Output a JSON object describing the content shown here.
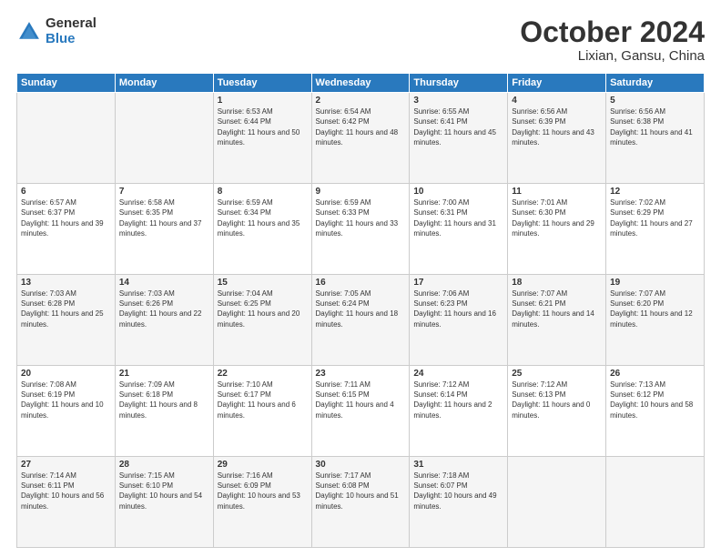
{
  "logo": {
    "general": "General",
    "blue": "Blue"
  },
  "title": {
    "month": "October 2024",
    "location": "Lixian, Gansu, China"
  },
  "days_of_week": [
    "Sunday",
    "Monday",
    "Tuesday",
    "Wednesday",
    "Thursday",
    "Friday",
    "Saturday"
  ],
  "weeks": [
    [
      {
        "day": "",
        "sunrise": "",
        "sunset": "",
        "daylight": ""
      },
      {
        "day": "",
        "sunrise": "",
        "sunset": "",
        "daylight": ""
      },
      {
        "day": "1",
        "sunrise": "Sunrise: 6:53 AM",
        "sunset": "Sunset: 6:44 PM",
        "daylight": "Daylight: 11 hours and 50 minutes."
      },
      {
        "day": "2",
        "sunrise": "Sunrise: 6:54 AM",
        "sunset": "Sunset: 6:42 PM",
        "daylight": "Daylight: 11 hours and 48 minutes."
      },
      {
        "day": "3",
        "sunrise": "Sunrise: 6:55 AM",
        "sunset": "Sunset: 6:41 PM",
        "daylight": "Daylight: 11 hours and 45 minutes."
      },
      {
        "day": "4",
        "sunrise": "Sunrise: 6:56 AM",
        "sunset": "Sunset: 6:39 PM",
        "daylight": "Daylight: 11 hours and 43 minutes."
      },
      {
        "day": "5",
        "sunrise": "Sunrise: 6:56 AM",
        "sunset": "Sunset: 6:38 PM",
        "daylight": "Daylight: 11 hours and 41 minutes."
      }
    ],
    [
      {
        "day": "6",
        "sunrise": "Sunrise: 6:57 AM",
        "sunset": "Sunset: 6:37 PM",
        "daylight": "Daylight: 11 hours and 39 minutes."
      },
      {
        "day": "7",
        "sunrise": "Sunrise: 6:58 AM",
        "sunset": "Sunset: 6:35 PM",
        "daylight": "Daylight: 11 hours and 37 minutes."
      },
      {
        "day": "8",
        "sunrise": "Sunrise: 6:59 AM",
        "sunset": "Sunset: 6:34 PM",
        "daylight": "Daylight: 11 hours and 35 minutes."
      },
      {
        "day": "9",
        "sunrise": "Sunrise: 6:59 AM",
        "sunset": "Sunset: 6:33 PM",
        "daylight": "Daylight: 11 hours and 33 minutes."
      },
      {
        "day": "10",
        "sunrise": "Sunrise: 7:00 AM",
        "sunset": "Sunset: 6:31 PM",
        "daylight": "Daylight: 11 hours and 31 minutes."
      },
      {
        "day": "11",
        "sunrise": "Sunrise: 7:01 AM",
        "sunset": "Sunset: 6:30 PM",
        "daylight": "Daylight: 11 hours and 29 minutes."
      },
      {
        "day": "12",
        "sunrise": "Sunrise: 7:02 AM",
        "sunset": "Sunset: 6:29 PM",
        "daylight": "Daylight: 11 hours and 27 minutes."
      }
    ],
    [
      {
        "day": "13",
        "sunrise": "Sunrise: 7:03 AM",
        "sunset": "Sunset: 6:28 PM",
        "daylight": "Daylight: 11 hours and 25 minutes."
      },
      {
        "day": "14",
        "sunrise": "Sunrise: 7:03 AM",
        "sunset": "Sunset: 6:26 PM",
        "daylight": "Daylight: 11 hours and 22 minutes."
      },
      {
        "day": "15",
        "sunrise": "Sunrise: 7:04 AM",
        "sunset": "Sunset: 6:25 PM",
        "daylight": "Daylight: 11 hours and 20 minutes."
      },
      {
        "day": "16",
        "sunrise": "Sunrise: 7:05 AM",
        "sunset": "Sunset: 6:24 PM",
        "daylight": "Daylight: 11 hours and 18 minutes."
      },
      {
        "day": "17",
        "sunrise": "Sunrise: 7:06 AM",
        "sunset": "Sunset: 6:23 PM",
        "daylight": "Daylight: 11 hours and 16 minutes."
      },
      {
        "day": "18",
        "sunrise": "Sunrise: 7:07 AM",
        "sunset": "Sunset: 6:21 PM",
        "daylight": "Daylight: 11 hours and 14 minutes."
      },
      {
        "day": "19",
        "sunrise": "Sunrise: 7:07 AM",
        "sunset": "Sunset: 6:20 PM",
        "daylight": "Daylight: 11 hours and 12 minutes."
      }
    ],
    [
      {
        "day": "20",
        "sunrise": "Sunrise: 7:08 AM",
        "sunset": "Sunset: 6:19 PM",
        "daylight": "Daylight: 11 hours and 10 minutes."
      },
      {
        "day": "21",
        "sunrise": "Sunrise: 7:09 AM",
        "sunset": "Sunset: 6:18 PM",
        "daylight": "Daylight: 11 hours and 8 minutes."
      },
      {
        "day": "22",
        "sunrise": "Sunrise: 7:10 AM",
        "sunset": "Sunset: 6:17 PM",
        "daylight": "Daylight: 11 hours and 6 minutes."
      },
      {
        "day": "23",
        "sunrise": "Sunrise: 7:11 AM",
        "sunset": "Sunset: 6:15 PM",
        "daylight": "Daylight: 11 hours and 4 minutes."
      },
      {
        "day": "24",
        "sunrise": "Sunrise: 7:12 AM",
        "sunset": "Sunset: 6:14 PM",
        "daylight": "Daylight: 11 hours and 2 minutes."
      },
      {
        "day": "25",
        "sunrise": "Sunrise: 7:12 AM",
        "sunset": "Sunset: 6:13 PM",
        "daylight": "Daylight: 11 hours and 0 minutes."
      },
      {
        "day": "26",
        "sunrise": "Sunrise: 7:13 AM",
        "sunset": "Sunset: 6:12 PM",
        "daylight": "Daylight: 10 hours and 58 minutes."
      }
    ],
    [
      {
        "day": "27",
        "sunrise": "Sunrise: 7:14 AM",
        "sunset": "Sunset: 6:11 PM",
        "daylight": "Daylight: 10 hours and 56 minutes."
      },
      {
        "day": "28",
        "sunrise": "Sunrise: 7:15 AM",
        "sunset": "Sunset: 6:10 PM",
        "daylight": "Daylight: 10 hours and 54 minutes."
      },
      {
        "day": "29",
        "sunrise": "Sunrise: 7:16 AM",
        "sunset": "Sunset: 6:09 PM",
        "daylight": "Daylight: 10 hours and 53 minutes."
      },
      {
        "day": "30",
        "sunrise": "Sunrise: 7:17 AM",
        "sunset": "Sunset: 6:08 PM",
        "daylight": "Daylight: 10 hours and 51 minutes."
      },
      {
        "day": "31",
        "sunrise": "Sunrise: 7:18 AM",
        "sunset": "Sunset: 6:07 PM",
        "daylight": "Daylight: 10 hours and 49 minutes."
      },
      {
        "day": "",
        "sunrise": "",
        "sunset": "",
        "daylight": ""
      },
      {
        "day": "",
        "sunrise": "",
        "sunset": "",
        "daylight": ""
      }
    ]
  ]
}
